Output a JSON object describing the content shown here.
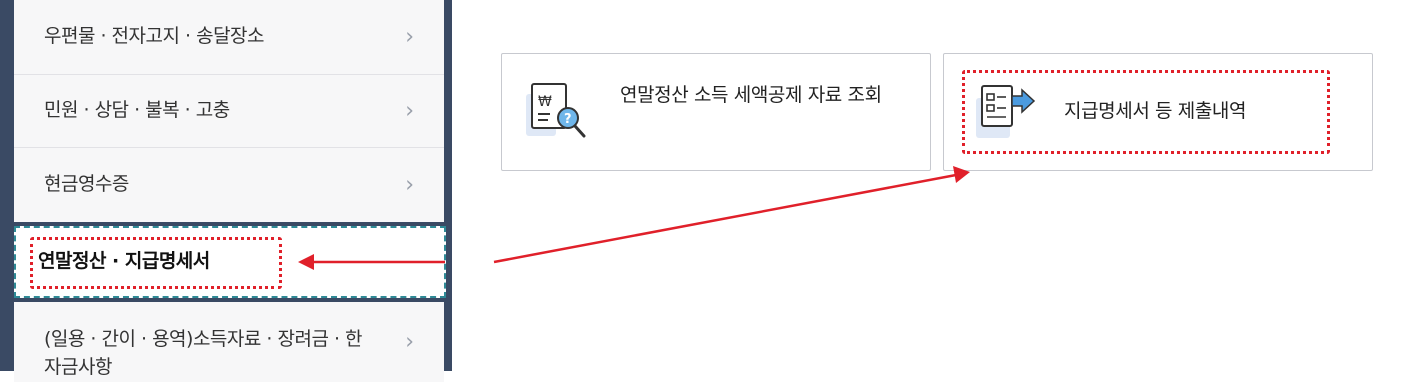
{
  "sidebar": {
    "items": [
      {
        "label": "우편물 · 전자고지 · 송달장소",
        "has_chevron": true
      },
      {
        "label": "민원 · 상담 · 불복 · 고충",
        "has_chevron": true
      },
      {
        "label": "현금영수증",
        "has_chevron": true
      },
      {
        "label": "연말정산 · 지급명세서",
        "has_chevron": false,
        "selected": true
      },
      {
        "label": "(일용 · 간이 · 용역)소득자료 · 장려금 · 한자금사항",
        "has_chevron": true
      }
    ],
    "chevron_glyph": "›"
  },
  "cards": [
    {
      "title": "연말정산 소득 세액공제 자료 조회",
      "icon": "receipt-search-icon"
    },
    {
      "title": "지급명세서 등 제출내역",
      "icon": "document-submit-icon"
    }
  ],
  "annotations": {
    "highlight_color": "#e0202a",
    "selected_border_color": "#2f8a96"
  }
}
